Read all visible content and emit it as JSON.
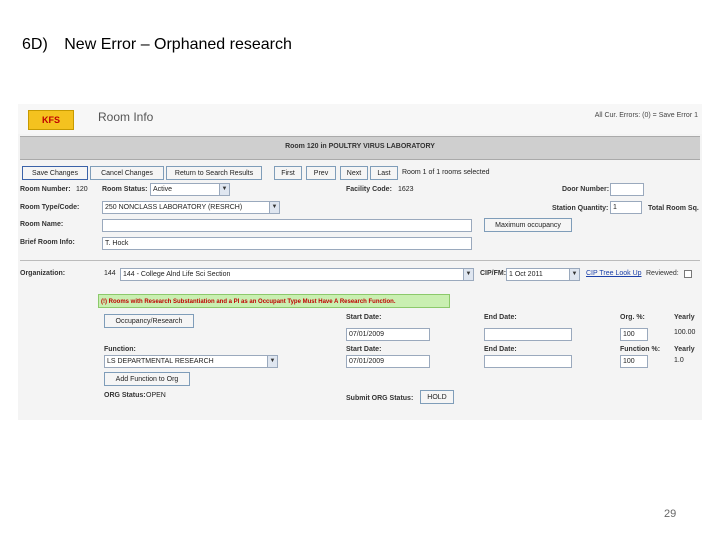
{
  "slide": {
    "number": "6D)",
    "title": "New Error – Orphaned research",
    "page_number": "29"
  },
  "app": {
    "logo": "KFS",
    "doc_title": "Room Info",
    "error_summary": "All Cur. Errors: (0) = Save Error 1",
    "room_header": "Room 120 in POULTRY VIRUS LABORATORY"
  },
  "toolbar": {
    "save": "Save Changes",
    "cancel": "Cancel Changes",
    "return": "Return to Search Results",
    "first": "First",
    "prev": "Prev",
    "next": "Next",
    "last": "Last",
    "selection_info": "Room 1 of 1 rooms selected"
  },
  "form": {
    "room_number_label": "Room Number:",
    "room_number_value": "120",
    "room_status_label": "Room Status:",
    "room_status_value": "Active",
    "facility_code_label": "Facility Code:",
    "facility_code_value": "1623",
    "door_number_label": "Door Number:",
    "door_number_value": "",
    "room_type_label": "Room Type/Code:",
    "room_type_value": "250 NONCLASS LABORATORY (RESRCH)",
    "station_quantity_label": "Station Quantity:",
    "station_quantity_value": "1",
    "total_room_label": "Total Room Sq.",
    "room_name_label": "Room Name:",
    "room_name_value": "",
    "max_occupancy_button": "Maximum occupancy",
    "brief_room_info_label": "Brief Room Info:",
    "brief_room_info_value": "T. Hock",
    "organization_label": "Organization:",
    "organization_code": "144",
    "organization_value": "144 - College Alnd Life Sci Section",
    "cip_label": "CIP/FM:",
    "cip_value": "1 Oct 2011",
    "cip_link": "CIP Tree Look Up",
    "reviewed_label": "Reviewed:",
    "warning": "(!) Rooms with Research Substantiation and a PI as an Occupant Type Must Have A Research Function.",
    "occupancy_button": "Occupancy/Research",
    "start_date_label": "Start Date:",
    "start_date_value_1": "07/01/2009",
    "end_date_label": "End Date:",
    "end_date_value_1": "",
    "org_pct_label": "Org. %:",
    "org_pct_value": "100",
    "yearly_label_1": "Yearly",
    "yearly_value_1": "100.00",
    "function_label": "Function:",
    "function_value": "LS DEPARTMENTAL RESEARCH",
    "start_date_value_2": "07/01/2009",
    "end_date_value_2": "",
    "function_pct_label": "Function %:",
    "function_pct_value": "100",
    "yearly_label_2": "Yearly",
    "yearly_value_2": "1.0",
    "add_function_button": "Add Function to Org",
    "org_status_label": "ORG Status:",
    "org_status_value": "OPEN",
    "submit_org_label": "Submit ORG Status:",
    "hold_button": "HOLD"
  }
}
